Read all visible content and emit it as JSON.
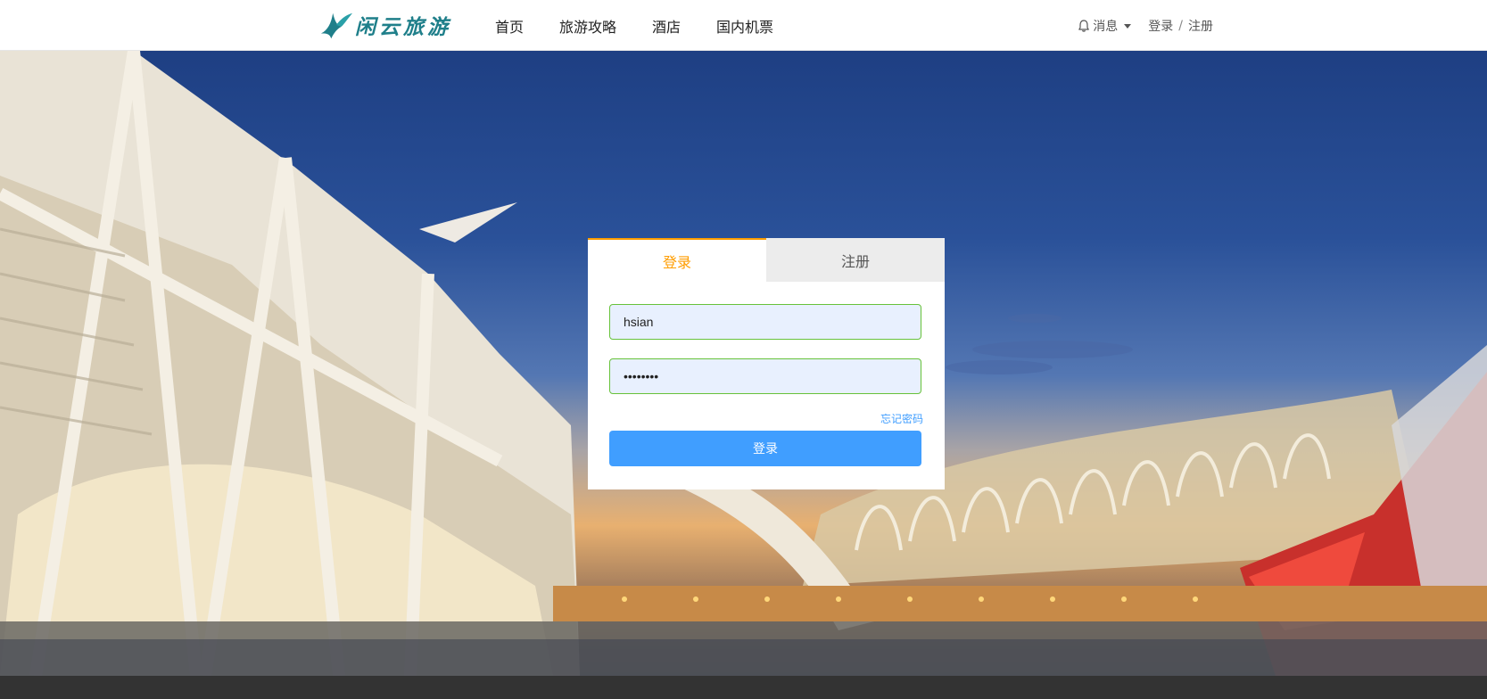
{
  "brand": {
    "name": "闲云旅游",
    "logo_icon": "bird-logo-icon",
    "color": "#1f7f8a"
  },
  "nav": {
    "items": [
      {
        "label": "首页"
      },
      {
        "label": "旅游攻略"
      },
      {
        "label": "酒店"
      },
      {
        "label": "国内机票"
      }
    ]
  },
  "header_right": {
    "messages_label": "消息",
    "messages_icon": "bell-icon",
    "dropdown_icon": "caret-down-icon",
    "login_link": "登录",
    "separator": "/",
    "register_link": "注册"
  },
  "login_form": {
    "tabs": [
      {
        "label": "登录",
        "active": true
      },
      {
        "label": "注册",
        "active": false
      }
    ],
    "username_value": "hsian",
    "password_value": "••••••••",
    "forgot_label": "忘记密码",
    "submit_label": "登录"
  },
  "colors": {
    "accent_orange": "#ff9d00",
    "primary_blue": "#409eff",
    "valid_green": "#67c23a",
    "footer_dark": "#333333"
  }
}
